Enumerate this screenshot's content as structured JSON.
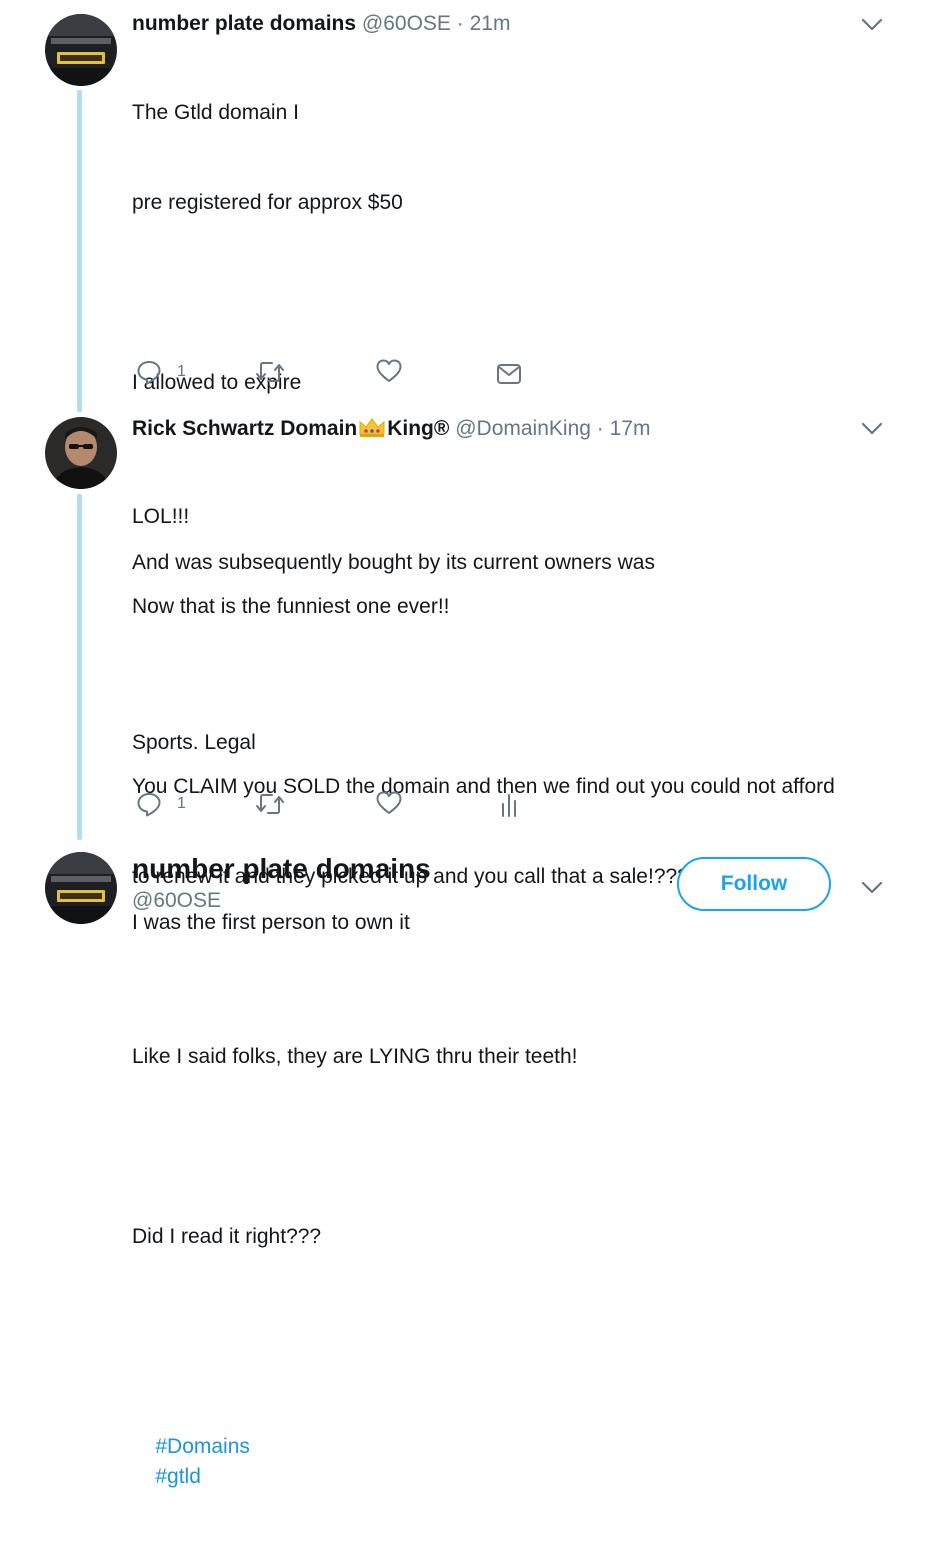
{
  "tweets": [
    {
      "name": "number plate domains",
      "handle": "@60OSE",
      "time": "· 21m",
      "lines": [
        "The Gtld domain I",
        "pre registered for approx $50",
        "",
        "I allowed to expire",
        "",
        "And was subsequently bought by its current owners was",
        "",
        "Sports. Legal",
        "",
        "I was the first person to own it"
      ],
      "reply_count": "1"
    },
    {
      "name_part1": "Rick Schwartz Domain",
      "name_part2": "King®",
      "handle": "@DomainKing",
      "time": "· 17m",
      "lines": [
        "LOL!!!",
        "Now that is the funniest one ever!!",
        "",
        "You CLAIM you SOLD the domain and then we find out you could not afford",
        "to renew it and they picked it up and you call that a sale!????",
        "",
        "Like I said folks, they are LYING thru their teeth!",
        "",
        "Did I read it right???",
        ""
      ],
      "hashtags": [
        "#Domains",
        "#gtld"
      ],
      "reply_count": "1"
    }
  ],
  "profile": {
    "name": "number plate domains",
    "handle": "@60OSE",
    "follow_label": "Follow"
  },
  "icons": [
    "chevron-down-icon",
    "reply-icon",
    "retweet-icon",
    "like-icon",
    "message-icon",
    "analytics-icon",
    "crown-icon"
  ],
  "colors": {
    "accent": "#1da1f2",
    "hashtag": "#1b95e0",
    "thread": "#b3dcf3",
    "muted": "#657786"
  }
}
